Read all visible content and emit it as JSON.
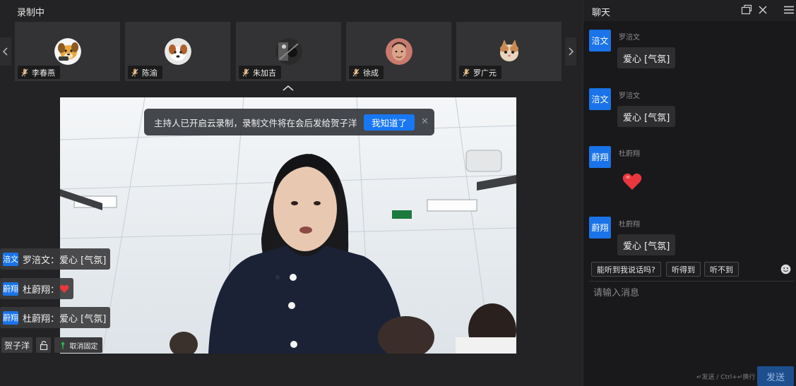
{
  "meeting": {
    "status_title": "录制中",
    "participants": [
      {
        "name": "李春燕",
        "avatar": "dog-cartoon-avatar"
      },
      {
        "name": "陈渝",
        "avatar": "dog-photo-avatar"
      },
      {
        "name": "朱加吉",
        "avatar": "dark-photo-avatar"
      },
      {
        "name": "徐成",
        "avatar": "person-photo-avatar"
      },
      {
        "name": "罗广元",
        "avatar": "cat-photo-avatar"
      }
    ],
    "toast": {
      "text": "主持人已开启云录制，录制文件将在会后发给贺子洋",
      "button": "我知道了",
      "close": "✕"
    },
    "overlay_messages": [
      {
        "tag": "涪文",
        "text": "罗涪文：爱心 [气氛]"
      },
      {
        "tag": "蔚翔",
        "text": "杜蔚翔：",
        "emoji": "red-heart"
      },
      {
        "tag": "蔚翔",
        "text": "杜蔚翔：爱心 [气氛]"
      }
    ],
    "bottom": {
      "speaker_name": "贺子洋",
      "unpin_label": "取消固定"
    }
  },
  "chat": {
    "title": "聊天",
    "messages": [
      {
        "avatar_text": "涪文",
        "sender": "罗涪文",
        "content": "爱心 [气氛]"
      },
      {
        "avatar_text": "涪文",
        "sender": "罗涪文",
        "content": "爱心 [气氛]"
      },
      {
        "avatar_text": "蔚翔",
        "sender": "杜蔚翔",
        "content": "",
        "emoji": "red-heart"
      },
      {
        "avatar_text": "蔚翔",
        "sender": "杜蔚翔",
        "content": "爱心 [气氛]"
      }
    ],
    "quick_replies": [
      "能听到我说话吗?",
      "听得到",
      "听不到"
    ],
    "input_placeholder": "请输入消息",
    "send_hint": "↵发送 / Ctrl+↵换行",
    "send_label": "发送"
  },
  "colors": {
    "accent": "#1a73e8",
    "toast_button": "#1877f2",
    "heart": "#e8383d"
  }
}
